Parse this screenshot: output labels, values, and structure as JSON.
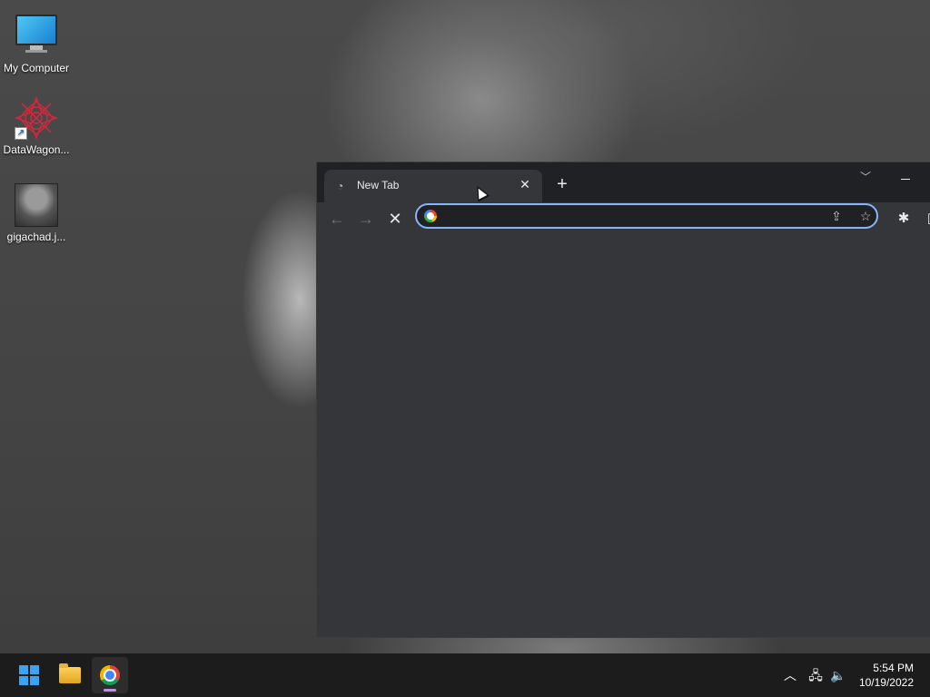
{
  "desktop": {
    "icons": [
      {
        "label": "My Computer",
        "icon": "monitor-icon"
      },
      {
        "label": "DataWagon...",
        "icon": "red-star-logo-icon"
      },
      {
        "label": "gigachad.j...",
        "icon": "image-thumbnail-icon"
      }
    ]
  },
  "browser": {
    "tab": {
      "title": "New Tab",
      "favicon": "chrome-favicon",
      "close_symbol": "✕"
    },
    "new_tab_symbol": "+",
    "omnibox": {
      "value": "",
      "placeholder": ""
    },
    "nav": {
      "back": "←",
      "forward": "→",
      "stop": "✕"
    },
    "toolbar_icons": [
      "share-icon",
      "bookmark-star-icon",
      "extensions-icon",
      "side-panel-icon"
    ]
  },
  "taskbar": {
    "apps": [
      "start-button",
      "file-explorer",
      "chrome"
    ],
    "clock": {
      "time": "5:54 PM",
      "date": "10/19/2022"
    },
    "tray": [
      "chevron-up-icon",
      "network-icon",
      "volume-icon"
    ]
  },
  "colors": {
    "omnibox_focus": "#8ab4f8",
    "chrome_active_indicator": "#c58af9"
  }
}
